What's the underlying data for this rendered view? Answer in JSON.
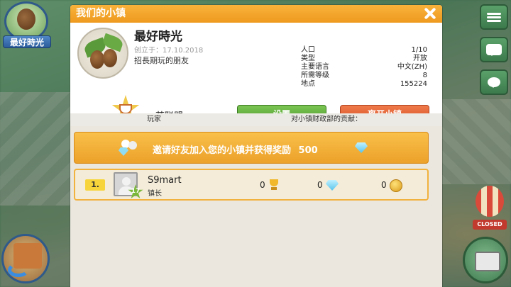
{
  "background": {
    "town_badge_label": "最好時光",
    "balloon_sign": "CLOSED"
  },
  "dialog": {
    "title": "我们的小镇",
    "town": {
      "name": "最好時光",
      "created_label": "创立于：",
      "created_date": "17.10.2018",
      "description": "招長期玩的朋友"
    },
    "stats": [
      {
        "label": "人口",
        "value": "1/10"
      },
      {
        "label": "类型",
        "value": "开放"
      },
      {
        "label": "主要语言",
        "value": "中文(ZH)"
      },
      {
        "label": "所需等级",
        "value": "8"
      },
      {
        "label": "地点",
        "value": "155224"
      }
    ],
    "league": {
      "name": "茶联盟"
    },
    "buttons": {
      "settings": "设置",
      "leave": "离开小镇"
    },
    "columns": {
      "player": "玩家",
      "contribution": "对小镇财政部的贡献："
    },
    "invite": {
      "text": "邀请好友加入您的小镇并获得奖励",
      "reward": "500"
    },
    "members": [
      {
        "rank": "1.",
        "level": "17",
        "name": "S9mart",
        "role": "镇长",
        "trophies": "0",
        "gems": "0",
        "coins": "0"
      }
    ]
  },
  "colors": {
    "title_bar": "#f4a62c",
    "settings_button": "#5fae3a",
    "leave_button": "#e0613a",
    "invite_bar": "#f2ae36"
  }
}
